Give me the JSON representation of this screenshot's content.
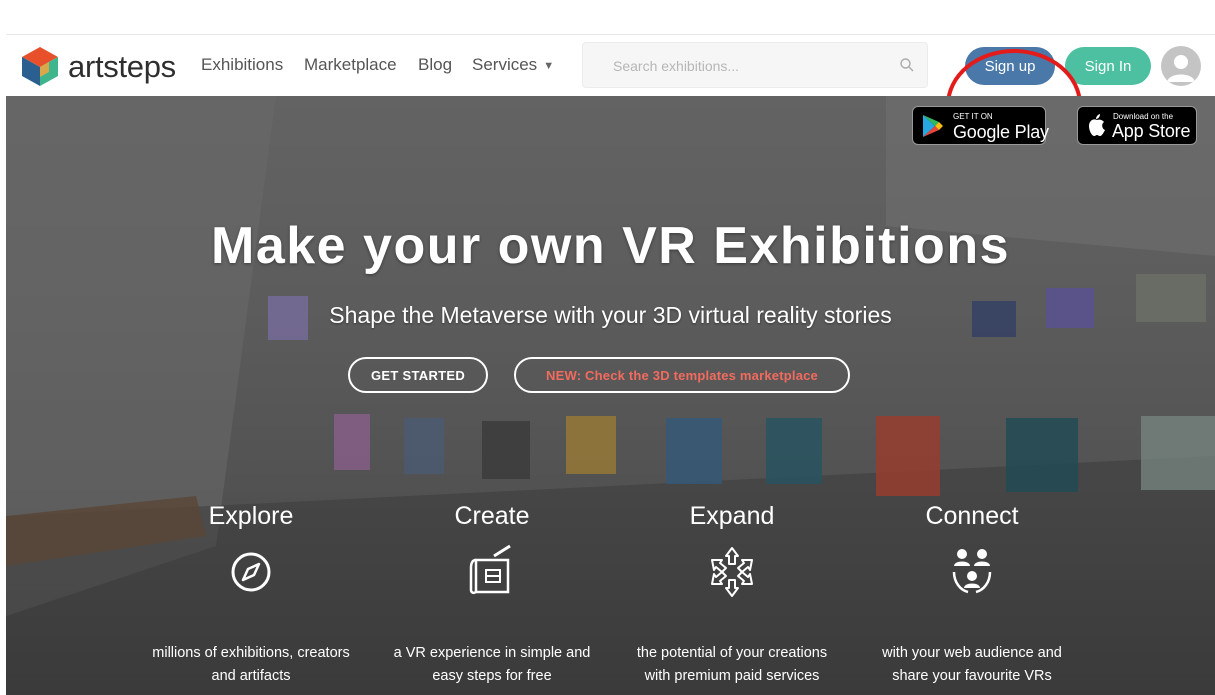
{
  "header": {
    "logo_text": "artsteps",
    "nav": [
      {
        "label": "Exhibitions"
      },
      {
        "label": "Marketplace"
      },
      {
        "label": "Blog"
      },
      {
        "label": "Services"
      }
    ],
    "search_placeholder": "Search exhibitions...",
    "signup_label": "Sign up",
    "signin_label": "Sign In"
  },
  "hero": {
    "google_play": {
      "small": "GET IT ON",
      "big": "Google Play"
    },
    "app_store": {
      "small": "Download on the",
      "big": "App Store"
    },
    "title": "Make your own VR Exhibitions",
    "subtitle": "Shape the Metaverse with your 3D virtual reality stories",
    "get_started_label": "GET STARTED",
    "marketplace_label": "NEW: Check the 3D templates marketplace"
  },
  "features": [
    {
      "title": "Explore",
      "icon": "compass-icon",
      "line1": "millions of exhibitions, creators",
      "line2": "and artifacts"
    },
    {
      "title": "Create",
      "icon": "blueprint-icon",
      "line1": "a VR experience in simple and",
      "line2": "easy steps for free"
    },
    {
      "title": "Expand",
      "icon": "expand-arrows-icon",
      "line1": "the potential of your creations",
      "line2": "with premium paid services"
    },
    {
      "title": "Connect",
      "icon": "people-connect-icon",
      "line1": "with your web audience and",
      "line2": "share your favourite VRs"
    }
  ],
  "colors": {
    "signup": "#4a78a8",
    "signin": "#4cc0a1",
    "marketplace_text": "#f26b5e",
    "annotation": "#e41b1b"
  }
}
